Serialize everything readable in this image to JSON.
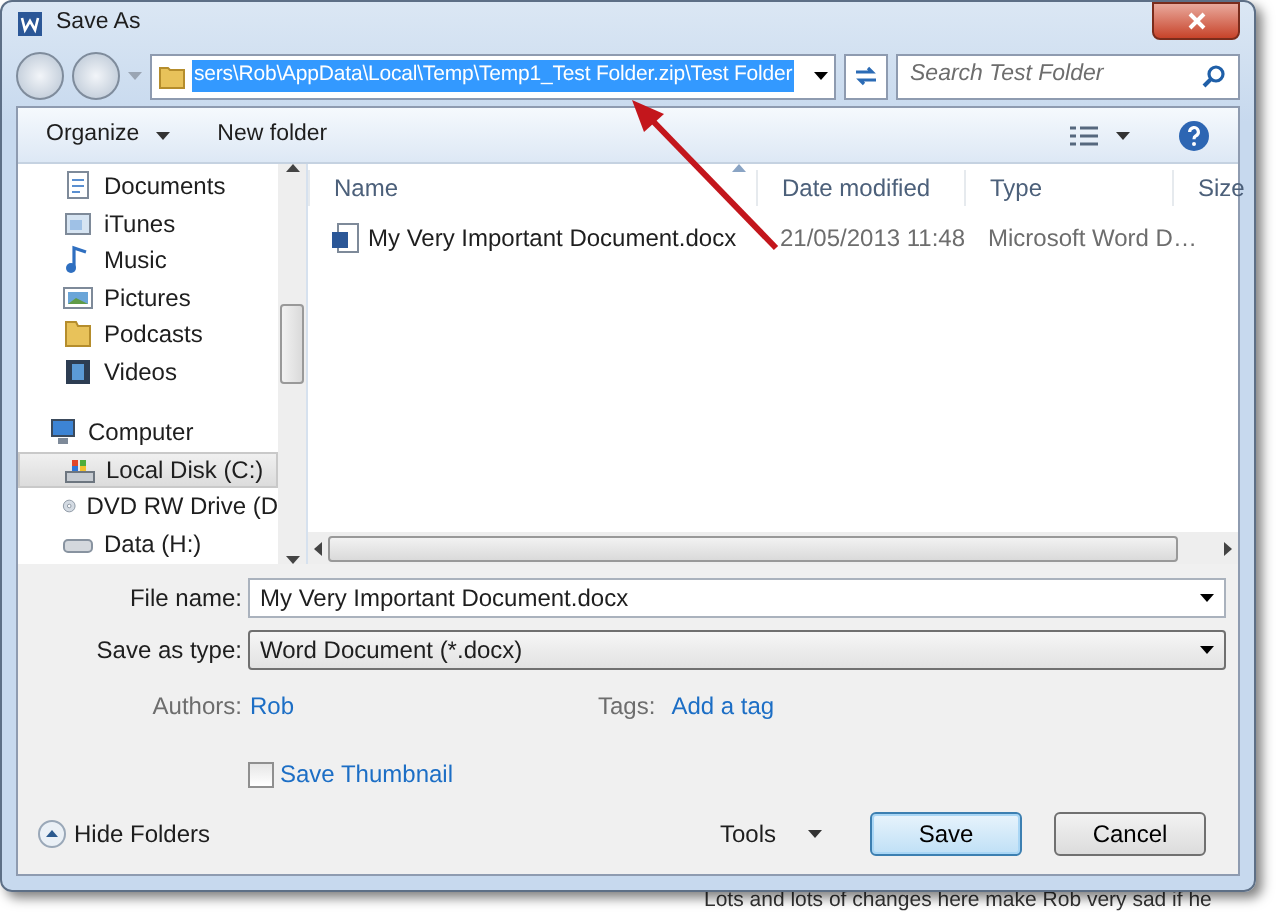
{
  "window": {
    "title": "Save As"
  },
  "address_bar": {
    "path": "sers\\Rob\\AppData\\Local\\Temp\\Temp1_Test Folder.zip\\Test Folder",
    "selected": true
  },
  "search": {
    "placeholder": "Search Test Folder"
  },
  "toolbar": {
    "organize": "Organize",
    "new_folder": "New folder"
  },
  "sidebar": {
    "items": [
      {
        "label": "Documents",
        "kind": "documents",
        "selected": false
      },
      {
        "label": "iTunes",
        "kind": "itunes",
        "selected": false
      },
      {
        "label": "Music",
        "kind": "music",
        "selected": false
      },
      {
        "label": "Pictures",
        "kind": "pictures",
        "selected": false
      },
      {
        "label": "Podcasts",
        "kind": "folder",
        "selected": false
      },
      {
        "label": "Videos",
        "kind": "videos",
        "selected": false
      },
      {
        "label": "Computer",
        "kind": "computer",
        "selected": false,
        "children": [
          {
            "label": "Local Disk (C:)",
            "kind": "disk",
            "selected": true
          },
          {
            "label": "DVD RW Drive (D",
            "kind": "dvd",
            "selected": false
          },
          {
            "label": "Data (H:)",
            "kind": "drive",
            "selected": false
          }
        ]
      }
    ]
  },
  "table": {
    "columns": [
      "Name",
      "Date modified",
      "Type",
      "Size"
    ],
    "rows": [
      {
        "cells": [
          "My Very Important Document.docx",
          "21/05/2013 11:48",
          "Microsoft Word D…"
        ],
        "selected": false
      }
    ]
  },
  "form": {
    "file_name": {
      "label": "File name:",
      "value": "My Very Important Document.docx"
    },
    "save_as_type": {
      "label": "Save as type:",
      "value": "Word Document (*.docx)"
    },
    "authors": {
      "label": "Authors:",
      "value": "Rob"
    },
    "tags": {
      "label": "Tags:",
      "value": "Add a tag"
    },
    "save_thumbnail": {
      "label": "Save Thumbnail",
      "checked": false
    }
  },
  "footer": {
    "hide_folders": "Hide Folders",
    "tools": "Tools",
    "buttons": [
      {
        "label": "Save",
        "default": true
      },
      {
        "label": "Cancel",
        "default": false
      }
    ]
  },
  "background_text": "Lots and lots of changes here make Rob very sad if he"
}
